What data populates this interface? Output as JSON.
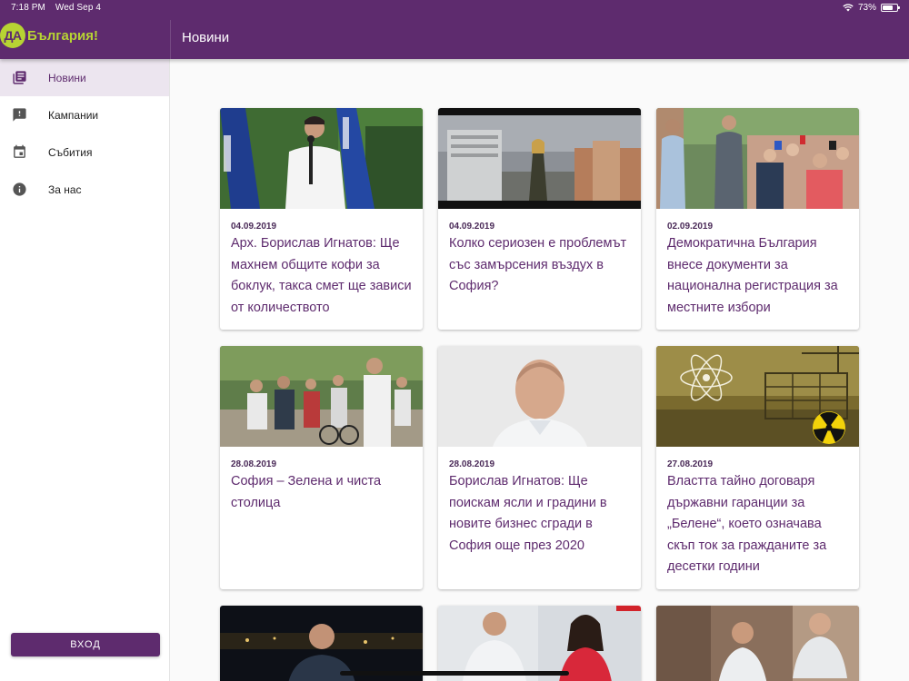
{
  "status_bar": {
    "time": "7:18 PM",
    "date": "Wed Sep 4",
    "battery": "73%",
    "battery_level": 0.73
  },
  "brand": {
    "badge": "ДА",
    "name": "България!"
  },
  "app_bar": {
    "title": "Новини"
  },
  "sidebar": {
    "items": [
      {
        "label": "Новини",
        "icon": "newspaper-icon",
        "active": true
      },
      {
        "label": "Кампании",
        "icon": "feedback-icon",
        "active": false
      },
      {
        "label": "Събития",
        "icon": "calendar-icon",
        "active": false
      },
      {
        "label": "За нас",
        "icon": "info-icon",
        "active": false
      }
    ],
    "login_label": "ВХОД"
  },
  "articles": [
    {
      "date": "04.09.2019",
      "title": "Арх. Борислав Игнатов: Ще махнем общите кофи за боклук, такса смет ще зависи от количеството"
    },
    {
      "date": "04.09.2019",
      "title": "Колко сериозен е проблемът със замърсения въздух в София?"
    },
    {
      "date": "02.09.2019",
      "title": "Демократична България внесе документи за национална регистрация за местните избори"
    },
    {
      "date": "28.08.2019",
      "title": "София – Зелена и чиста столица"
    },
    {
      "date": "28.08.2019",
      "title": "Борислав Игнатов: Ще поискам ясли и градини в новите бизнес сгради в София още през 2020"
    },
    {
      "date": "27.08.2019",
      "title": "Властта тайно договаря държавни гаранции за „Белене“, което означава скъп ток за гражданите за десетки години"
    },
    {
      "date": "",
      "title": ""
    },
    {
      "date": "",
      "title": ""
    },
    {
      "date": "",
      "title": ""
    }
  ],
  "colors": {
    "primary": "#5e2b6e",
    "accent": "#b7d433",
    "background": "#fafafa"
  }
}
